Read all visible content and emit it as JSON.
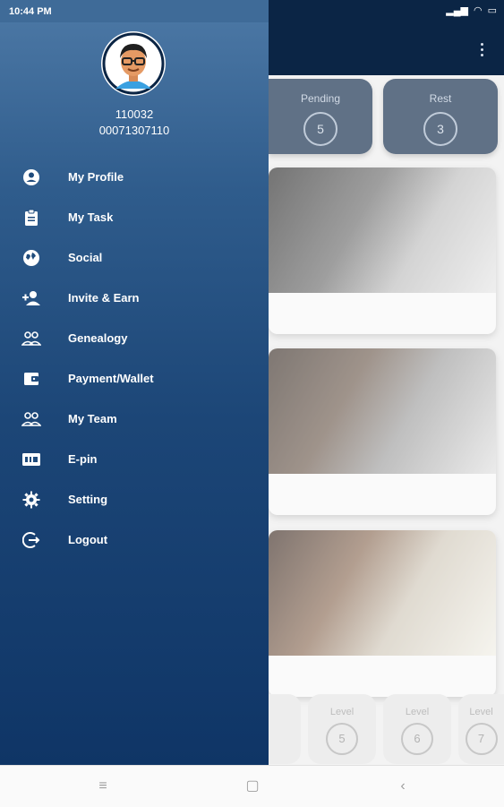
{
  "status_bar": {
    "time": "10:44 PM"
  },
  "user": {
    "id": "110032",
    "phone": "00071307110"
  },
  "menu": [
    {
      "label": "My Profile",
      "icon": "account-circle-icon"
    },
    {
      "label": "My Task",
      "icon": "clipboard-icon"
    },
    {
      "label": "Social",
      "icon": "globe-icon"
    },
    {
      "label": "Invite & Earn",
      "icon": "add-person-icon"
    },
    {
      "label": "Genealogy",
      "icon": "people-outline-icon"
    },
    {
      "label": "Payment/Wallet",
      "icon": "wallet-icon"
    },
    {
      "label": "My Team",
      "icon": "team-icon"
    },
    {
      "label": "E-pin",
      "icon": "pin-card-icon"
    },
    {
      "label": "Setting",
      "icon": "gear-icon"
    },
    {
      "label": "Logout",
      "icon": "logout-icon"
    }
  ],
  "background": {
    "stats": [
      {
        "label": "Pending",
        "value": "5"
      },
      {
        "label": "Rest",
        "value": "3"
      }
    ],
    "levels": [
      {
        "label": "Level",
        "value": "5"
      },
      {
        "label": "Level",
        "value": "6"
      },
      {
        "label": "Level",
        "value": "7"
      }
    ]
  },
  "colors": {
    "drawer_top": "#4d79a6",
    "drawer_bottom": "#0f3566",
    "header": "#0b2545"
  }
}
